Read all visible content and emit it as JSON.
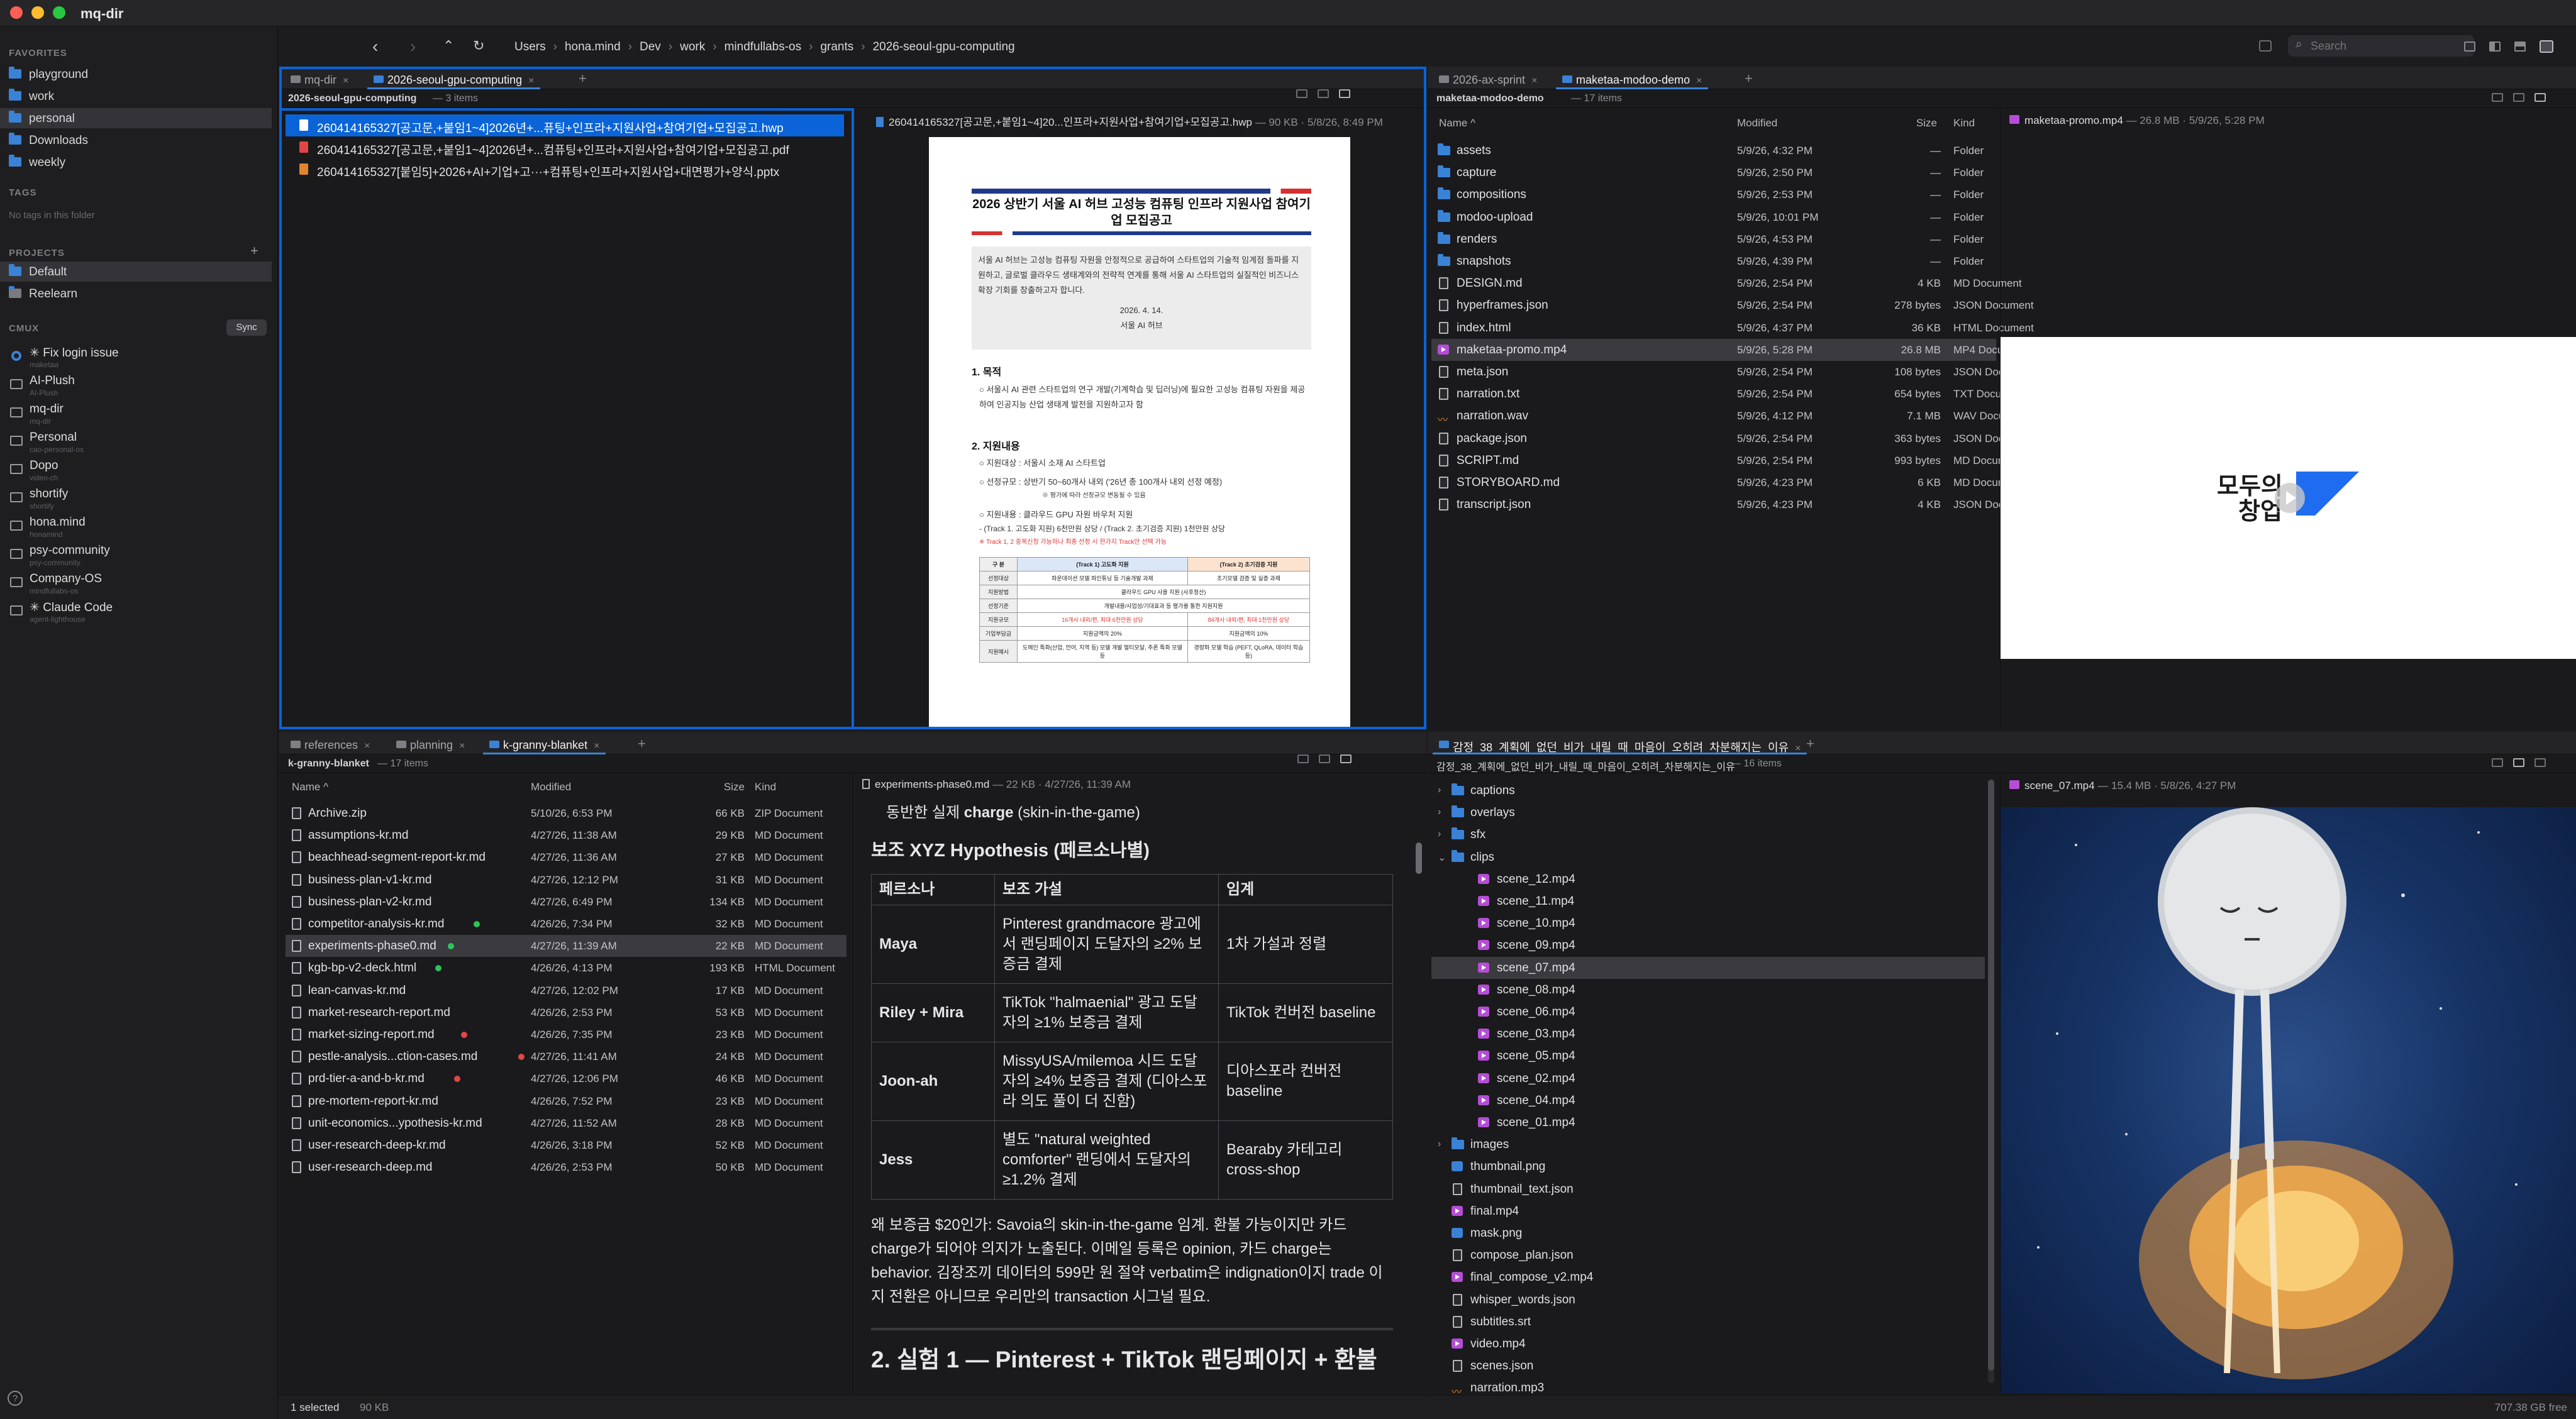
{
  "window": {
    "title": "mq-dir"
  },
  "sidebar": {
    "favorites_title": "FAVORITES",
    "favorites": [
      "playground",
      "work",
      "personal",
      "Downloads",
      "weekly"
    ],
    "tags_title": "TAGS",
    "tags_empty": "No tags in this folder",
    "projects_title": "PROJECTS",
    "projects_add": "+",
    "projects": [
      "Default",
      "Reelearn"
    ],
    "cmux_title": "CMUX",
    "sync_label": "Sync",
    "cmux": [
      {
        "title": "✳ Fix login issue",
        "sub": "maketaa"
      },
      {
        "title": "AI-Plush",
        "sub": "AI-Plush"
      },
      {
        "title": "mq-dir",
        "sub": "mq-dir"
      },
      {
        "title": "Personal",
        "sub": "cao-personal-os"
      },
      {
        "title": "Dopo",
        "sub": "video-ch"
      },
      {
        "title": "shortify",
        "sub": "shortify"
      },
      {
        "title": "hona.mind",
        "sub": "honamind"
      },
      {
        "title": "psy-community",
        "sub": "psy-community"
      },
      {
        "title": "Company-OS",
        "sub": "mindfullabs-os"
      },
      {
        "title": "✳ Claude Code",
        "sub": "agent-lighthouse"
      }
    ],
    "help_icon": "?"
  },
  "toolbar": {
    "breadcrumb": [
      "Users",
      "hona.mind",
      "Dev",
      "work",
      "mindfullabs-os",
      "grants",
      "2026-seoul-gpu-computing"
    ],
    "search_placeholder": "Search"
  },
  "pane1": {
    "tabs": [
      {
        "label": "mq-dir"
      },
      {
        "label": "2026-seoul-gpu-computing"
      }
    ],
    "add": "+",
    "path": "2026-seoul-gpu-computing",
    "count": "3 items",
    "files": [
      "260414165327[공고문,+붙임1~4]2026년+...퓨팅+인프라+지원사업+참여기업+모집공고.hwp",
      "260414165327[공고문,+붙임1~4]2026년+...컴퓨팅+인프라+지원사업+참여기업+모집공고.pdf",
      "260414165327[붙임5]+2026+AI+기업+고···+컴퓨팅+인프라+지원사업+대면평가+양식.pptx"
    ],
    "preview_name": "260414165327[공고문,+붙임1~4]20...인프라+지원사업+참여기업+모집공고.hwp",
    "preview_meta": "90 KB · 5/8/26, 8:49 PM",
    "doc": {
      "title": "2026 상반기 서울 AI 허브 고성능 컴퓨팅 인프라 지원사업 참여기업 모집공고",
      "intro": "서울 AI 허브는 고성능 컴퓨팅 자원을 안정적으로 공급하여 스타트업의 기술적 임계점 돌파를 지원하고, 글로벌 클라우드 생태계와의 전략적 연계를 통해 서울 AI 스타트업의 실질적인 비즈니스 확장 기회를 창출하고자 합니다.",
      "date": "2026. 4. 14.",
      "org": "서울 AI 허브",
      "s1": "1. 목적",
      "s1_body": "○ 서울시 AI 관련 스타트업의 연구 개발(기계학습 및 딥러닝)에 필요한 고성능 컴퓨팅 자원을 제공하여 인공지능 산업 생태계 발전을 지원하고자 함",
      "s2": "2. 지원내용",
      "b1": "○ 지원대상 : 서울시 소재 AI 스타트업",
      "b2": "○ 선정규모 : 상반기 50~60개사 내외 ('26년 총 100개사 내외 선정 예정)",
      "b2n": "※ 평가에 따라 선정규모 변동될 수 있음",
      "b3": "○ 지원내용 : 클라우드 GPU 자원 바우처 지원",
      "b4": "- (Track 1. 고도화 지원) 6천만원 상당 / (Track 2. 초기검증 지원) 1천만원 상당",
      "b4n": "※ Track 1, 2 중복신청 가능하나 최종 선정 시 한가지 Track만 선택 가능",
      "table": [
        [
          "구 분",
          "(Track 1) 고도화 지원",
          "(Track 2) 초기검증 지원"
        ],
        [
          "선정대상",
          "파운데이션 모델 파인튜닝 등 기술개발 과제",
          "초기모델 검증 및 실증 과제"
        ],
        [
          "지원방법",
          "클라우드 GPU 사용 지원 (사후정산)",
          ""
        ],
        [
          "선정기준",
          "개발내용/사업성/기대효과 등 평가를 통한 지원지원",
          ""
        ],
        [
          "지원규모",
          "16개사 내외/편, 최대 6천만원 상당",
          "84개사 내외/편, 최대 1천만원 상당"
        ],
        [
          "기업부담금",
          "지원금액의 20%",
          "지원금액의 10%"
        ],
        [
          "지원예시",
          "도메인 특화(산업, 언어, 지역 등) 모델 개발 멀티모달, 추론 특화 모델 등",
          "경량화 모델 학습 (PEFT, QLoRA, 데이터 학습 등)"
        ]
      ]
    }
  },
  "pane2": {
    "tabs": [
      {
        "label": "2026-ax-sprint"
      },
      {
        "label": "maketaa-modoo-demo"
      }
    ],
    "add": "+",
    "path": "maketaa-modoo-demo",
    "count": "17 items",
    "cols": {
      "name": "Name ^",
      "modified": "Modified",
      "size": "Size",
      "kind": "Kind"
    },
    "files": [
      {
        "name": "assets",
        "mod": "5/9/26, 4:32 PM",
        "size": "—",
        "kind": "Folder",
        "t": "folder"
      },
      {
        "name": "capture",
        "mod": "5/9/26, 2:50 PM",
        "size": "—",
        "kind": "Folder",
        "t": "folder"
      },
      {
        "name": "compositions",
        "mod": "5/9/26, 2:53 PM",
        "size": "—",
        "kind": "Folder",
        "t": "folder"
      },
      {
        "name": "modoo-upload",
        "mod": "5/9/26, 10:01 PM",
        "size": "—",
        "kind": "Folder",
        "t": "folder"
      },
      {
        "name": "renders",
        "mod": "5/9/26, 4:53 PM",
        "size": "—",
        "kind": "Folder",
        "t": "folder"
      },
      {
        "name": "snapshots",
        "mod": "5/9/26, 4:39 PM",
        "size": "—",
        "kind": "Folder",
        "t": "folder"
      },
      {
        "name": "DESIGN.md",
        "mod": "5/9/26, 2:54 PM",
        "size": "4 KB",
        "kind": "MD Document",
        "t": "doc"
      },
      {
        "name": "hyperframes.json",
        "mod": "5/9/26, 2:54 PM",
        "size": "278 bytes",
        "kind": "JSON Document",
        "t": "doc"
      },
      {
        "name": "index.html",
        "mod": "5/9/26, 4:37 PM",
        "size": "36 KB",
        "kind": "HTML Document",
        "t": "doc"
      },
      {
        "name": "maketaa-promo.mp4",
        "mod": "5/9/26, 5:28 PM",
        "size": "26.8 MB",
        "kind": "MP4 Document",
        "t": "vid"
      },
      {
        "name": "meta.json",
        "mod": "5/9/26, 2:54 PM",
        "size": "108 bytes",
        "kind": "JSON Document",
        "t": "doc"
      },
      {
        "name": "narration.txt",
        "mod": "5/9/26, 2:54 PM",
        "size": "654 bytes",
        "kind": "TXT Document",
        "t": "doc"
      },
      {
        "name": "narration.wav",
        "mod": "5/9/26, 4:12 PM",
        "size": "7.1 MB",
        "kind": "WAV Document",
        "t": "aud"
      },
      {
        "name": "package.json",
        "mod": "5/9/26, 2:54 PM",
        "size": "363 bytes",
        "kind": "JSON Document",
        "t": "doc"
      },
      {
        "name": "SCRIPT.md",
        "mod": "5/9/26, 2:54 PM",
        "size": "993 bytes",
        "kind": "MD Document",
        "t": "doc"
      },
      {
        "name": "STORYBOARD.md",
        "mod": "5/9/26, 4:23 PM",
        "size": "6 KB",
        "kind": "MD Document",
        "t": "doc"
      },
      {
        "name": "transcript.json",
        "mod": "5/9/26, 4:23 PM",
        "size": "4 KB",
        "kind": "JSON Document",
        "t": "doc"
      }
    ],
    "preview_name": "maketaa-promo.mp4",
    "preview_meta": "26.8 MB · 5/9/26, 5:28 PM",
    "video_text_1": "모두의",
    "video_text_2": "창업"
  },
  "pane3": {
    "tabs": [
      {
        "label": "references"
      },
      {
        "label": "planning"
      },
      {
        "label": "k-granny-blanket"
      }
    ],
    "add": "+",
    "path": "k-granny-blanket",
    "count": "17 items",
    "cols": {
      "name": "Name ^",
      "modified": "Modified",
      "size": "Size",
      "kind": "Kind"
    },
    "files": [
      {
        "name": "Archive.zip",
        "mod": "5/10/26, 6:53 PM",
        "size": "66 KB",
        "kind": "ZIP Document",
        "dot": ""
      },
      {
        "name": "assumptions-kr.md",
        "mod": "4/27/26, 11:38 AM",
        "size": "29 KB",
        "kind": "MD Document",
        "dot": ""
      },
      {
        "name": "beachhead-segment-report-kr.md",
        "mod": "4/27/26, 11:36 AM",
        "size": "27 KB",
        "kind": "MD Document",
        "dot": ""
      },
      {
        "name": "business-plan-v1-kr.md",
        "mod": "4/27/26, 12:12 PM",
        "size": "31 KB",
        "kind": "MD Document",
        "dot": ""
      },
      {
        "name": "business-plan-v2-kr.md",
        "mod": "4/27/26, 6:49 PM",
        "size": "134 KB",
        "kind": "MD Document",
        "dot": ""
      },
      {
        "name": "competitor-analysis-kr.md",
        "mod": "4/26/26, 7:34 PM",
        "size": "32 KB",
        "kind": "MD Document",
        "dot": "#2fc25b"
      },
      {
        "name": "experiments-phase0.md",
        "mod": "4/27/26, 11:39 AM",
        "size": "22 KB",
        "kind": "MD Document",
        "dot": "#2fc25b"
      },
      {
        "name": "kgb-bp-v2-deck.html",
        "mod": "4/26/26, 4:13 PM",
        "size": "193 KB",
        "kind": "HTML Document",
        "dot": "#2fc25b"
      },
      {
        "name": "lean-canvas-kr.md",
        "mod": "4/27/26, 12:02 PM",
        "size": "17 KB",
        "kind": "MD Document",
        "dot": ""
      },
      {
        "name": "market-research-report.md",
        "mod": "4/26/26, 2:53 PM",
        "size": "53 KB",
        "kind": "MD Document",
        "dot": ""
      },
      {
        "name": "market-sizing-report.md",
        "mod": "4/26/26, 7:35 PM",
        "size": "23 KB",
        "kind": "MD Document",
        "dot": "#e04646"
      },
      {
        "name": "pestle-analysis...ction-cases.md",
        "mod": "4/27/26, 11:41 AM",
        "size": "24 KB",
        "kind": "MD Document",
        "dot": "#e04646"
      },
      {
        "name": "prd-tier-a-and-b-kr.md",
        "mod": "4/27/26, 12:06 PM",
        "size": "46 KB",
        "kind": "MD Document",
        "dot": "#e04646"
      },
      {
        "name": "pre-mortem-report-kr.md",
        "mod": "4/26/26, 7:52 PM",
        "size": "23 KB",
        "kind": "MD Document",
        "dot": ""
      },
      {
        "name": "unit-economics...ypothesis-kr.md",
        "mod": "4/27/26, 11:52 AM",
        "size": "28 KB",
        "kind": "MD Document",
        "dot": ""
      },
      {
        "name": "user-research-deep-kr.md",
        "mod": "4/26/26, 3:18 PM",
        "size": "52 KB",
        "kind": "MD Document",
        "dot": ""
      },
      {
        "name": "user-research-deep.md",
        "mod": "4/26/26, 2:53 PM",
        "size": "50 KB",
        "kind": "MD Document",
        "dot": ""
      }
    ],
    "preview_name": "experiments-phase0.md",
    "preview_meta": "22 KB · 4/27/26, 11:39 AM",
    "md": {
      "top_line_pre": "동반한 실제 ",
      "top_line_bold": "charge",
      "top_line_post": " (skin-in-the-game)",
      "h3": "보조 XYZ Hypothesis (페르소나별)",
      "th": [
        "페르소나",
        "보조 가설",
        "임계"
      ],
      "rows": [
        [
          "Maya",
          "Pinterest grandmacore 광고에서 랜딩페이지 도달자의 ≥2% 보증금 결제",
          "1차 가설과 정렬"
        ],
        [
          "Riley + Mira",
          "TikTok \"halmaenial\" 광고 도달자의 ≥1% 보증금 결제",
          "TikTok 컨버전 baseline"
        ],
        [
          "Joon-ah",
          "MissyUSA/milemoa 시드 도달자의 ≥4% 보증금 결제 (디아스포라 의도 풀이 더 진함)",
          "디아스포라 컨버전 baseline"
        ],
        [
          "Jess",
          "별도 \"natural weighted comforter\" 랜딩에서 도달자의 ≥1.2% 결제",
          "Bearaby 카테고리 cross-shop"
        ]
      ],
      "para": "왜 보증금 $20인가: Savoia의 skin-in-the-game 임계. 환불 가능이지만 카드 charge가 되어야 의지가 노출된다. 이메일 등록은 opinion, 카드 charge는 behavior. 김장조끼 데이터의 599만 원 절약 verbatim은 indignation이지 trade 이지 전환은 아니므로 우리만의 transaction 시그널 필요.",
      "h2": "2. 실험 1 — Pinterest + TikTok 랜딩페이지 + 환불"
    }
  },
  "pane4": {
    "tabs": [
      {
        "label": "감정_38_계획에_없던_비가_내릴_때_마음이_오히려_차분해지는_이유"
      }
    ],
    "add": "+",
    "path": "감정_38_계획에_없던_비가_내릴_때_마음이_오히려_차분해지는_이유",
    "count": "16 items",
    "items": [
      {
        "name": "captions",
        "t": "folder",
        "lvl": 0,
        "chev": "›"
      },
      {
        "name": "overlays",
        "t": "folder",
        "lvl": 0,
        "chev": "›"
      },
      {
        "name": "sfx",
        "t": "folder",
        "lvl": 0,
        "chev": "›"
      },
      {
        "name": "clips",
        "t": "folder",
        "lvl": 0,
        "chev": "⌄"
      },
      {
        "name": "scene_12.mp4",
        "t": "vid",
        "lvl": 1,
        "chev": ""
      },
      {
        "name": "scene_11.mp4",
        "t": "vid",
        "lvl": 1,
        "chev": ""
      },
      {
        "name": "scene_10.mp4",
        "t": "vid",
        "lvl": 1,
        "chev": ""
      },
      {
        "name": "scene_09.mp4",
        "t": "vid",
        "lvl": 1,
        "chev": ""
      },
      {
        "name": "scene_07.mp4",
        "t": "vid",
        "lvl": 1,
        "chev": ""
      },
      {
        "name": "scene_08.mp4",
        "t": "vid",
        "lvl": 1,
        "chev": ""
      },
      {
        "name": "scene_06.mp4",
        "t": "vid",
        "lvl": 1,
        "chev": ""
      },
      {
        "name": "scene_03.mp4",
        "t": "vid",
        "lvl": 1,
        "chev": ""
      },
      {
        "name": "scene_05.mp4",
        "t": "vid",
        "lvl": 1,
        "chev": ""
      },
      {
        "name": "scene_02.mp4",
        "t": "vid",
        "lvl": 1,
        "chev": ""
      },
      {
        "name": "scene_04.mp4",
        "t": "vid",
        "lvl": 1,
        "chev": ""
      },
      {
        "name": "scene_01.mp4",
        "t": "vid",
        "lvl": 1,
        "chev": ""
      },
      {
        "name": "images",
        "t": "folder",
        "lvl": 0,
        "chev": "›"
      },
      {
        "name": "thumbnail.png",
        "t": "img",
        "lvl": 0,
        "chev": ""
      },
      {
        "name": "thumbnail_text.json",
        "t": "doc",
        "lvl": 0,
        "chev": ""
      },
      {
        "name": "final.mp4",
        "t": "vid",
        "lvl": 0,
        "chev": ""
      },
      {
        "name": "mask.png",
        "t": "img",
        "lvl": 0,
        "chev": ""
      },
      {
        "name": "compose_plan.json",
        "t": "doc",
        "lvl": 0,
        "chev": ""
      },
      {
        "name": "final_compose_v2.mp4",
        "t": "vid",
        "lvl": 0,
        "chev": ""
      },
      {
        "name": "whisper_words.json",
        "t": "doc",
        "lvl": 0,
        "chev": ""
      },
      {
        "name": "subtitles.srt",
        "t": "doc",
        "lvl": 0,
        "chev": ""
      },
      {
        "name": "video.mp4",
        "t": "vid",
        "lvl": 0,
        "chev": ""
      },
      {
        "name": "scenes.json",
        "t": "doc",
        "lvl": 0,
        "chev": ""
      },
      {
        "name": "narration.mp3",
        "t": "aud",
        "lvl": 0,
        "chev": ""
      }
    ],
    "preview_name": "scene_07.mp4",
    "preview_meta": "15.4 MB · 5/8/26, 4:27 PM"
  },
  "status": {
    "selected": "1 selected",
    "size": "90 KB",
    "free": "707.38 GB free"
  }
}
